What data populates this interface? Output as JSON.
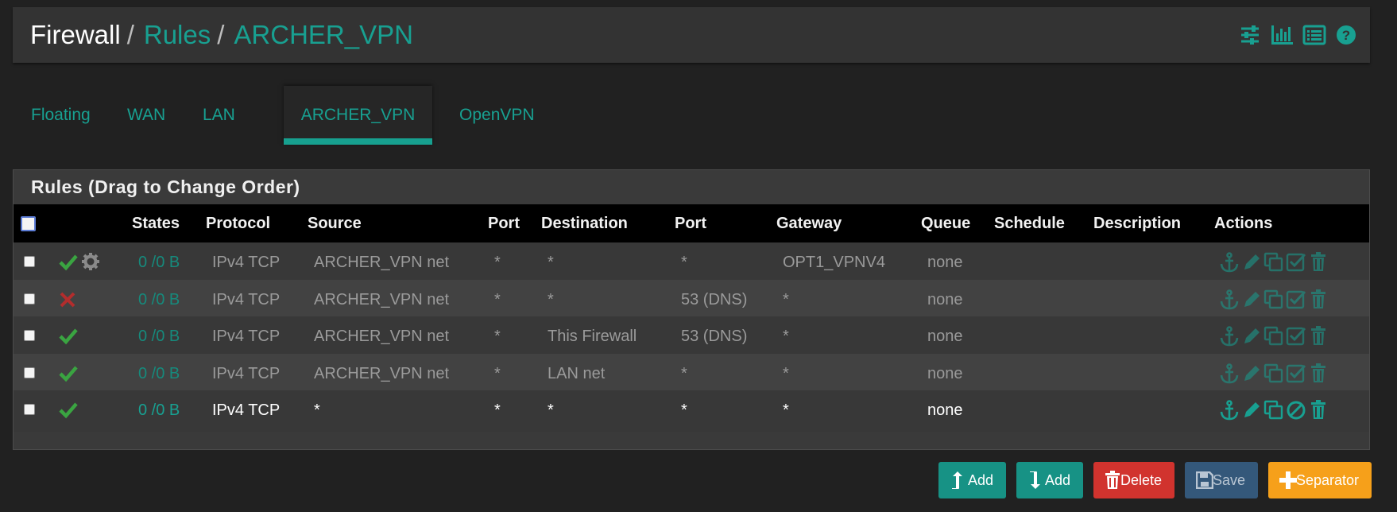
{
  "breadcrumb": {
    "items": [
      "Firewall",
      "Rules",
      "ARCHER_VPN"
    ],
    "separator": "/"
  },
  "header_icons": [
    "sliders-icon",
    "bar-chart-icon",
    "list-icon",
    "help-icon"
  ],
  "tabs": [
    {
      "label": "Floating",
      "active": false
    },
    {
      "label": "WAN",
      "active": false
    },
    {
      "label": "LAN",
      "active": false
    },
    {
      "label": "ARCHER_VPN",
      "active": true
    },
    {
      "label": "OpenVPN",
      "active": false
    }
  ],
  "panel": {
    "title": "Rules (Drag to Change Order)",
    "columns": [
      "States",
      "Protocol",
      "Source",
      "Port",
      "Destination",
      "Port",
      "Gateway",
      "Queue",
      "Schedule",
      "Description",
      "Actions"
    ]
  },
  "rules": [
    {
      "status": "pass",
      "extra_icon": "gear-icon",
      "states": "0 /0 B",
      "protocol": "IPv4 TCP",
      "source": "ARCHER_VPN net",
      "src_port": "*",
      "destination": "*",
      "dst_port": "*",
      "gateway": "OPT1_VPNV4",
      "queue": "none",
      "schedule": "",
      "description": "",
      "disabled": true,
      "toggle_icon": "check-square-icon"
    },
    {
      "status": "block",
      "extra_icon": "",
      "states": "0 /0 B",
      "protocol": "IPv4 TCP",
      "source": "ARCHER_VPN net",
      "src_port": "*",
      "destination": "*",
      "dst_port": "53 (DNS)",
      "gateway": "*",
      "queue": "none",
      "schedule": "",
      "description": "",
      "disabled": true,
      "toggle_icon": "check-square-icon"
    },
    {
      "status": "pass",
      "extra_icon": "",
      "states": "0 /0 B",
      "protocol": "IPv4 TCP",
      "source": "ARCHER_VPN net",
      "src_port": "*",
      "destination": "This Firewall",
      "dst_port": "53 (DNS)",
      "gateway": "*",
      "queue": "none",
      "schedule": "",
      "description": "",
      "disabled": true,
      "toggle_icon": "check-square-icon"
    },
    {
      "status": "pass",
      "extra_icon": "",
      "states": "0 /0 B",
      "protocol": "IPv4 TCP",
      "source": "ARCHER_VPN net",
      "src_port": "*",
      "destination": "LAN net",
      "dst_port": "*",
      "gateway": "*",
      "queue": "none",
      "schedule": "",
      "description": "",
      "disabled": true,
      "toggle_icon": "check-square-icon"
    },
    {
      "status": "pass",
      "extra_icon": "",
      "states": "0 /0 B",
      "protocol": "IPv4 TCP",
      "source": "*",
      "src_port": "*",
      "destination": "*",
      "dst_port": "*",
      "gateway": "*",
      "queue": "none",
      "schedule": "",
      "description": "",
      "disabled": false,
      "toggle_icon": "ban-icon"
    }
  ],
  "buttons": {
    "add_top": "Add",
    "add_bottom": "Add",
    "delete": "Delete",
    "save": "Save",
    "separator": "Separator"
  },
  "colors": {
    "accent": "#18a091",
    "pass": "#3aa441",
    "block": "#b32d2d",
    "delete": "#d1332e",
    "save": "#34587a",
    "separator": "#f6a01a"
  }
}
